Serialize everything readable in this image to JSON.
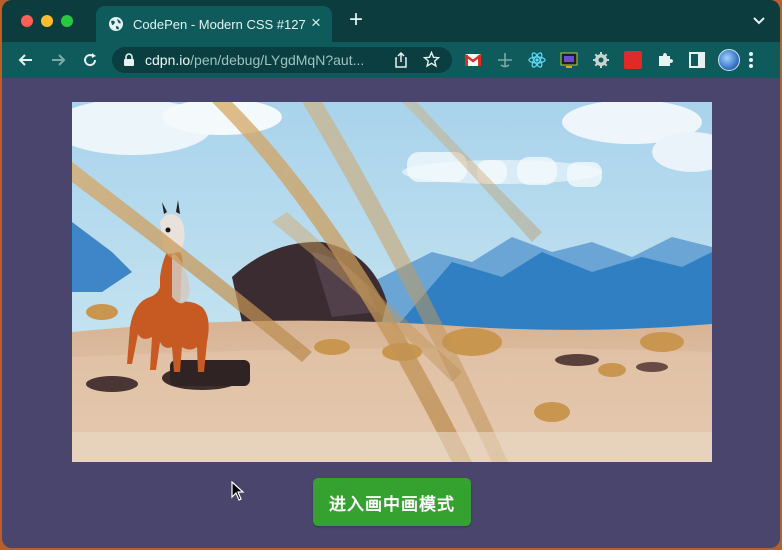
{
  "browser": {
    "tab_title": "CodePen - Modern CSS #127",
    "tab_close_glyph": "×",
    "new_tab_glyph": "+",
    "url_host": "cdpn.io",
    "url_path": "/pen/debug/LYgdMqN?aut..."
  },
  "extensions": [
    "gmail-icon",
    "bookmark-anchor-icon",
    "react-icon",
    "monitor-icon",
    "gear-icon",
    "red-square-icon",
    "puzzle-icon",
    "sidebar-icon"
  ],
  "page": {
    "pip_button_label": "进入画中画模式"
  },
  "colors": {
    "page_background": "#4a456c",
    "button_green": "#35a22f",
    "toolbar": "#0f5b5c",
    "tabstrip": "#0d3c3f"
  }
}
